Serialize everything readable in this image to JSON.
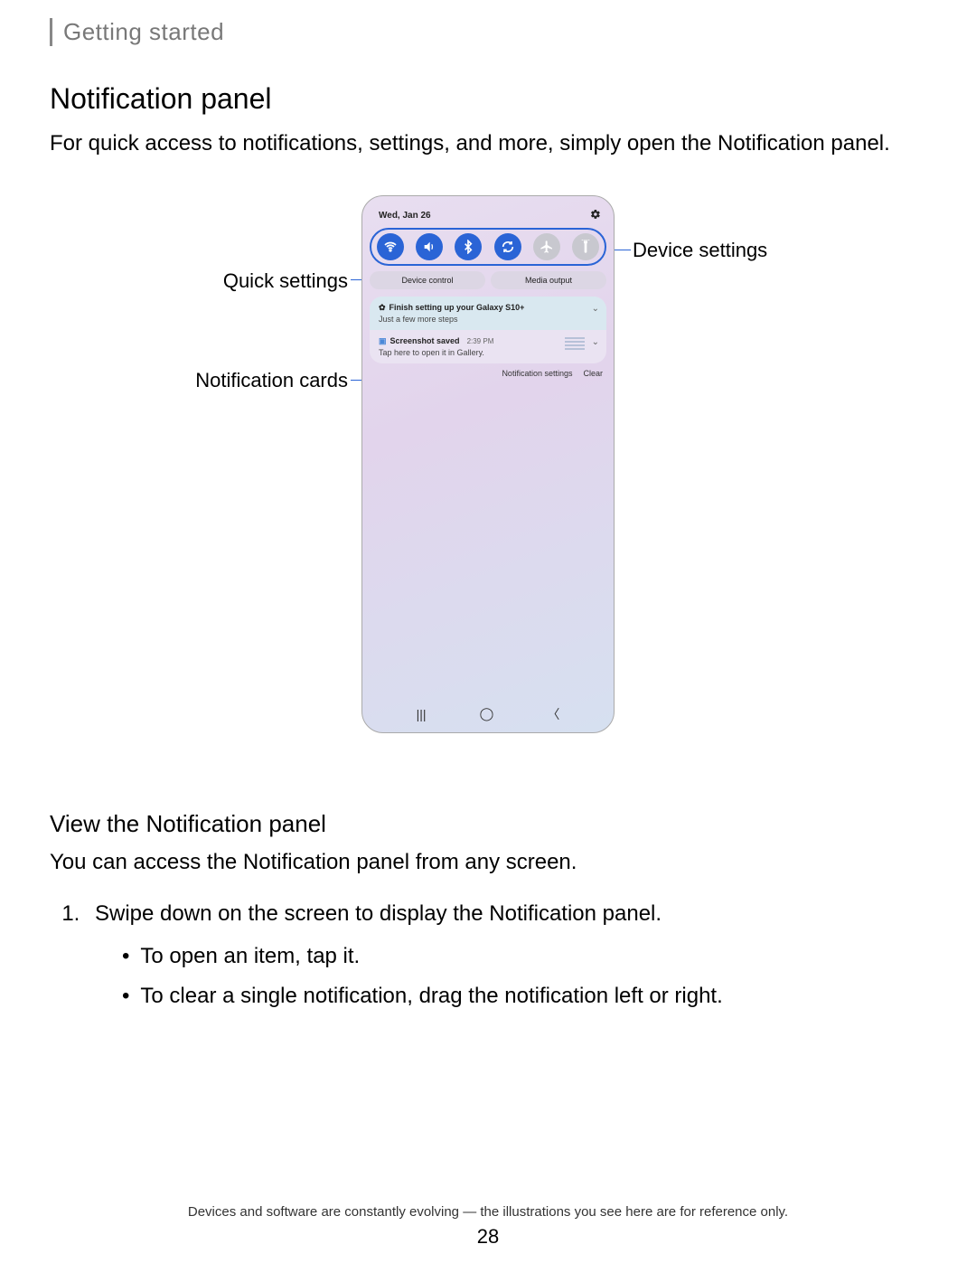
{
  "breadcrumb": "Getting started",
  "title": "Notification panel",
  "intro": "For quick access to notifications, settings, and more, simply open the Notification panel.",
  "callouts": {
    "quick_settings": "Quick settings",
    "notification_cards": "Notification cards",
    "device_settings": "Device settings"
  },
  "phone": {
    "date": "Wed, Jan 26",
    "quick_toggles": [
      {
        "icon": "wifi",
        "on": true
      },
      {
        "icon": "sound",
        "on": true
      },
      {
        "icon": "bluetooth",
        "on": true
      },
      {
        "icon": "rotate",
        "on": true
      },
      {
        "icon": "airplane",
        "on": false
      },
      {
        "icon": "flashlight",
        "on": false
      }
    ],
    "chips": [
      "Device control",
      "Media output"
    ],
    "notifications": [
      {
        "title": "Finish setting up your Galaxy S10+",
        "subtitle": "Just a few more steps"
      },
      {
        "title": "Screenshot saved",
        "time": "2:39 PM",
        "subtitle": "Tap here to open it in Gallery."
      }
    ],
    "notif_actions": [
      "Notification settings",
      "Clear"
    ]
  },
  "section2": {
    "heading": "View the Notification panel",
    "lead": "You can access the Notification panel from any screen.",
    "step1": "Swipe down on the screen to display the Notification panel.",
    "bullets": [
      "To open an item, tap it.",
      "To clear a single notification, drag the notification left or right."
    ]
  },
  "footnote": "Devices and software are constantly evolving — the illustrations you see here are for reference only.",
  "page_number": "28"
}
